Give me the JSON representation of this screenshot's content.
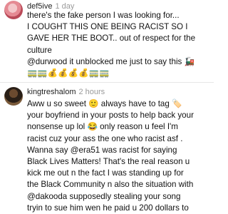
{
  "comments": [
    {
      "username": "def5ive",
      "time": "1 day",
      "lines": [
        "there's the fake person I was looking for...",
        "I COUGHT THIS ONE BEING RACIST SO I",
        "GAVE HER THE BOOT.. out of respect for the",
        "culture",
        "@durwood it unblocked me just to say this 🚂",
        "🚃🚃💰💰💰💰🚃🚃"
      ]
    },
    {
      "username": "kingtreshalom",
      "time": "2 hours",
      "lines": [
        "Aww u so sweet 🙂 always have to tag 🏷️",
        "your boyfriend in your posts to help back your",
        "nonsense up lol 😂 only reason u feel I'm",
        "racist cuz your ass the one who racist asf .",
        "Wanna say @era51 was racist for saying",
        "Black Lives Matters! That's the real reason u",
        "kick me out n the fact I was standing up for",
        "the Black Community n also the situation with",
        "@dakooda supposedly stealing your song",
        "tryin to sue him wen he paid u 200 dollars to"
      ]
    }
  ]
}
